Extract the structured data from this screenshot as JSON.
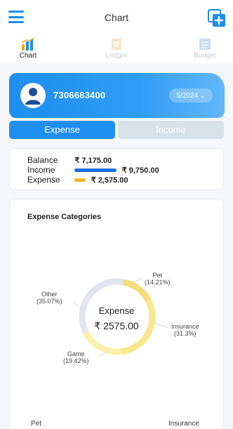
{
  "header": {
    "title": "Chart"
  },
  "tabs": [
    {
      "label": "Chart",
      "icon": "bar-chart-icon",
      "active": true
    },
    {
      "label": "Ledger",
      "icon": "ledger-icon",
      "active": false
    },
    {
      "label": "Budget",
      "icon": "budget-icon",
      "active": false
    }
  ],
  "account": {
    "phone": "7306683400",
    "period": "5/2024"
  },
  "segment": {
    "expense": "Expense",
    "income": "Income",
    "selected": "Expense"
  },
  "summary": {
    "balance_label": "Balance",
    "balance_value": "₹ 7,175.00",
    "income_label": "Income",
    "income_value": "₹ 9,750.00",
    "expense_label": "Expense",
    "expense_value": "₹ 2,575.00"
  },
  "colors": {
    "accent": "#1f8ef1",
    "income_bar": "#1f6fe0",
    "expense_bar": "#f2b51c"
  },
  "categories": {
    "title": "Expense Categories",
    "center_label": "Expense",
    "center_amount": "₹ 2575.00",
    "slices": [
      {
        "name": "Pet",
        "percent_text": "(14.21%)",
        "percent": 14.21,
        "color": "#f6dd7a"
      },
      {
        "name": "Insurance",
        "percent_text": "(31.3%)",
        "percent": 31.3,
        "color": "#f8e88e"
      },
      {
        "name": "Game",
        "percent_text": "(19.42%)",
        "percent": 19.42,
        "color": "#fbf0ad"
      },
      {
        "name": "Other",
        "percent_text": "(35.07%)",
        "percent": 35.07,
        "color": "#e2e4ee"
      }
    ],
    "bottom_left": "Pet",
    "bottom_right": "Insurance"
  }
}
